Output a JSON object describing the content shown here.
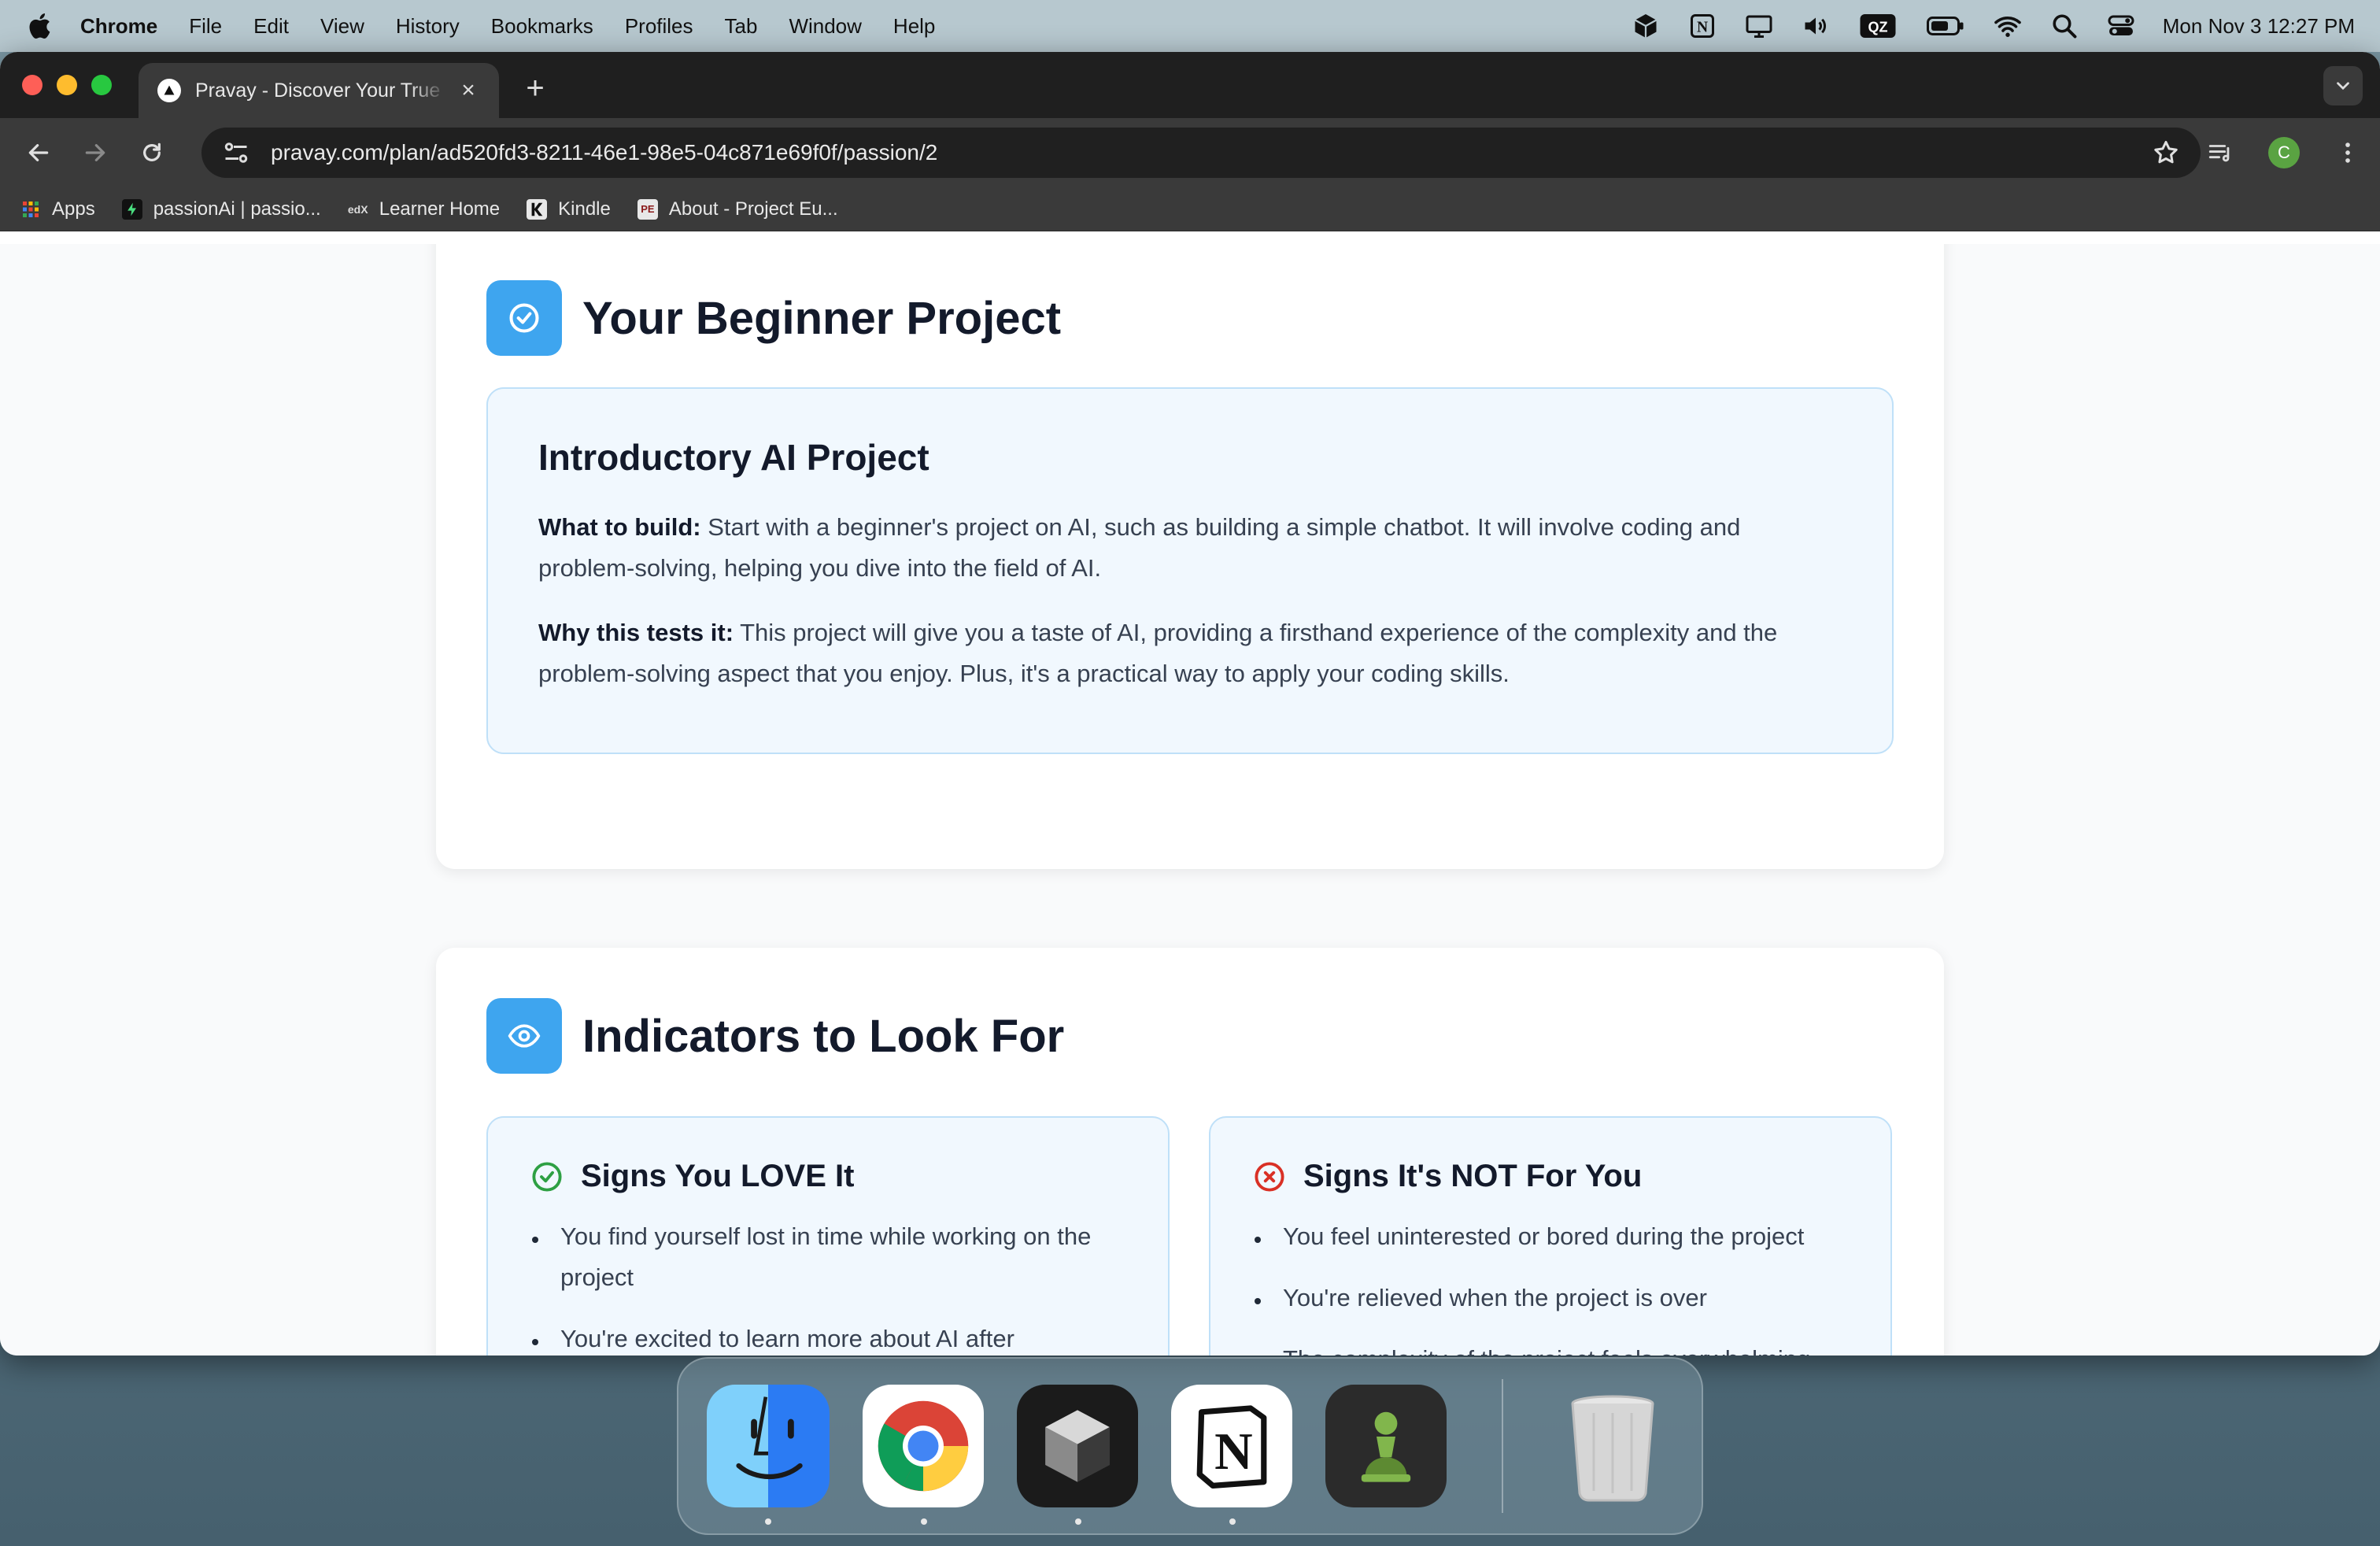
{
  "menubar": {
    "app_name": "Chrome",
    "items": [
      "File",
      "Edit",
      "View",
      "History",
      "Bookmarks",
      "Profiles",
      "Tab",
      "Window",
      "Help"
    ],
    "clock": "Mon Nov 3  12:27 PM",
    "status_icons": [
      "box-icon",
      "notion-status-icon",
      "display-icon",
      "volume-icon",
      "qz-icon",
      "battery-icon",
      "wifi-icon",
      "search-icon",
      "control-center-icon"
    ],
    "qz_label": "QZ",
    "notion_label": "N"
  },
  "browser": {
    "tab_title": "Pravay - Discover Your True Passion",
    "url": "pravay.com/plan/ad520fd3-8211-46e1-98e5-04c871e69f0f/passion/2",
    "profile_initial": "C",
    "bookmarks": [
      {
        "label": "Apps",
        "icon": "apps-grid-icon"
      },
      {
        "label": "passionAi | passio...",
        "icon": "passionai-icon"
      },
      {
        "label": "Learner Home",
        "icon": "edx-icon"
      },
      {
        "label": "Kindle",
        "icon": "kindle-icon"
      },
      {
        "label": "About - Project Eu...",
        "icon": "project-euler-icon"
      }
    ],
    "edx_glyph": "edX",
    "pe_glyph": "PE"
  },
  "page": {
    "beginner_section": {
      "title": "Your Beginner Project",
      "project_title": "Introductory AI Project",
      "what_label": "What to build:",
      "what_text": " Start with a beginner's project on AI, such as building a simple chatbot. It will involve coding and problem-solving, helping you dive into the field of AI.",
      "why_label": "Why this tests it:",
      "why_text": " This project will give you a taste of AI, providing a firsthand experience of the complexity and the problem-solving aspect that you enjoy. Plus, it's a practical way to apply your coding skills."
    },
    "indicators_section": {
      "title": "Indicators to Look For",
      "love": {
        "title": "Signs You LOVE It",
        "items": [
          "You find yourself lost in time while working on the project",
          "You're excited to learn more about AI after completing the project"
        ]
      },
      "not": {
        "title": "Signs It's NOT For You",
        "items": [
          "You feel uninterested or bored during the project",
          "You're relieved when the project is over",
          "The complexity of the project feels overwhelming, rather than exciting"
        ]
      }
    }
  },
  "dock": {
    "apps": [
      "Finder",
      "Chrome",
      "Cube",
      "Notion",
      "Chess",
      "Trash"
    ],
    "notion_glyph": "N"
  },
  "colors": {
    "accent_blue": "#3ea5ef",
    "box_bg": "#f1f8fe",
    "box_border": "#bfe0f8",
    "love_green": "#2ea043",
    "not_red": "#d93025"
  }
}
